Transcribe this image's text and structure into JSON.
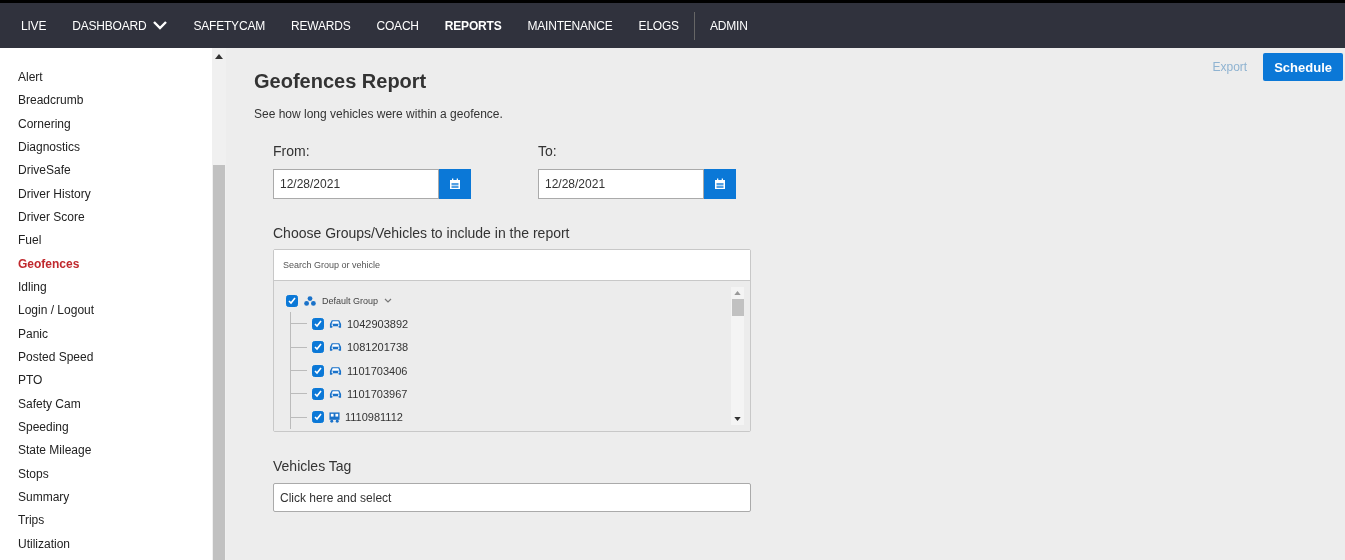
{
  "nav": {
    "items": [
      {
        "label": "LIVE",
        "selected": false,
        "dropdown": false
      },
      {
        "label": "DASHBOARD",
        "selected": false,
        "dropdown": true
      },
      {
        "label": "SAFETYCAM",
        "selected": false,
        "dropdown": false
      },
      {
        "label": "REWARDS",
        "selected": false,
        "dropdown": false
      },
      {
        "label": "COACH",
        "selected": false,
        "dropdown": false
      },
      {
        "label": "REPORTS",
        "selected": true,
        "dropdown": false
      },
      {
        "label": "MAINTENANCE",
        "selected": false,
        "dropdown": false
      },
      {
        "label": "ELOGS",
        "selected": false,
        "dropdown": false
      }
    ],
    "admin": "ADMIN"
  },
  "sidebar": {
    "items": [
      {
        "label": "Alert",
        "selected": false
      },
      {
        "label": "Breadcrumb",
        "selected": false
      },
      {
        "label": "Cornering",
        "selected": false
      },
      {
        "label": "Diagnostics",
        "selected": false
      },
      {
        "label": "DriveSafe",
        "selected": false
      },
      {
        "label": "Driver History",
        "selected": false
      },
      {
        "label": "Driver Score",
        "selected": false
      },
      {
        "label": "Fuel",
        "selected": false
      },
      {
        "label": "Geofences",
        "selected": true
      },
      {
        "label": "Idling",
        "selected": false
      },
      {
        "label": "Login / Logout",
        "selected": false
      },
      {
        "label": "Panic",
        "selected": false
      },
      {
        "label": "Posted Speed",
        "selected": false
      },
      {
        "label": "PTO",
        "selected": false
      },
      {
        "label": "Safety Cam",
        "selected": false
      },
      {
        "label": "Speeding",
        "selected": false
      },
      {
        "label": "State Mileage",
        "selected": false
      },
      {
        "label": "Stops",
        "selected": false
      },
      {
        "label": "Summary",
        "selected": false
      },
      {
        "label": "Trips",
        "selected": false
      },
      {
        "label": "Utilization",
        "selected": false
      }
    ]
  },
  "header": {
    "export": "Export",
    "schedule": "Schedule"
  },
  "report": {
    "title": "Geofences Report",
    "description": "See how long vehicles were within a geofence.",
    "from": {
      "label": "From:",
      "value": "12/28/2021"
    },
    "to": {
      "label": "To:",
      "value": "12/28/2021"
    },
    "groups_label": "Choose Groups/Vehicles to include in the report",
    "search": {
      "placeholder": "Search Group or vehicle"
    },
    "tree": [
      {
        "label": "Default Group",
        "kind": "group",
        "checked": true,
        "expanded": true,
        "children": [
          {
            "label": "1042903892",
            "kind": "car",
            "checked": true
          },
          {
            "label": "1081201738",
            "kind": "car",
            "checked": true
          },
          {
            "label": "1101703406",
            "kind": "car",
            "checked": true
          },
          {
            "label": "1101703967",
            "kind": "car",
            "checked": true
          },
          {
            "label": "1110981112",
            "kind": "trailer",
            "checked": true
          }
        ]
      }
    ],
    "vehicles_tag": {
      "label": "Vehicles Tag",
      "placeholder": "Click here and select"
    }
  }
}
